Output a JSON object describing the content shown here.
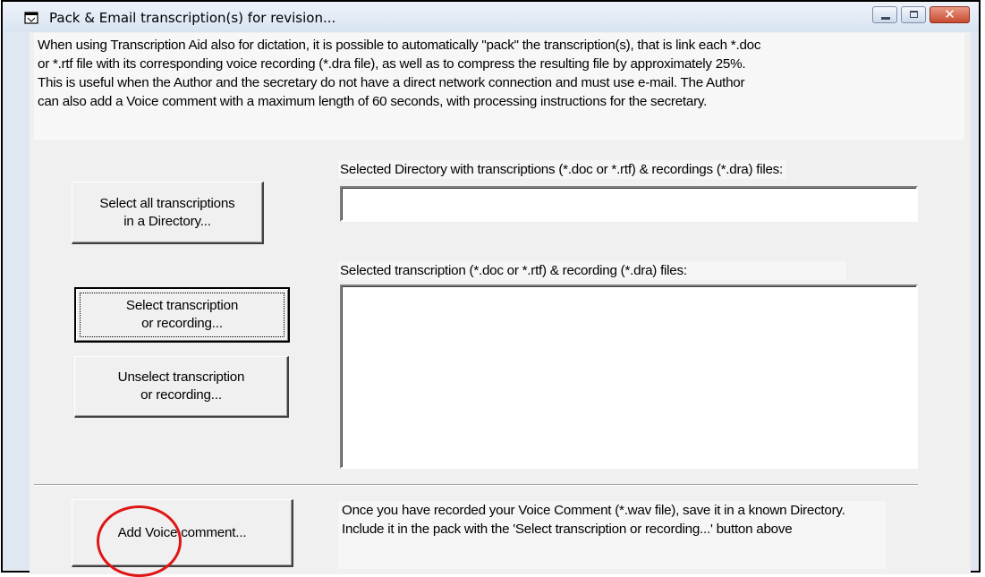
{
  "window": {
    "title": "Pack & Email transcription(s) for revision...",
    "close_glyph": "✕"
  },
  "intro_text": "When using Transcription Aid also for dictation, it is possible to automatically \"pack\" the transcription(s), that is link each *.doc\nor *.rtf file with its corresponding voice recording (*.dra file), as well as to compress the resulting file by approximately 25%.\nThis is useful when the Author and the secretary do not have a direct network connection and must use e-mail. The Author\ncan also add a Voice comment with a maximum length of 60 seconds, with processing instructions for the secretary.",
  "directory": {
    "label": "Selected Directory with transcriptions (*.doc or *.rtf) & recordings (*.dra) files:",
    "value": ""
  },
  "files": {
    "label": "Selected transcription (*.doc or *.rtf) & recording (*.dra) files:",
    "items": []
  },
  "buttons": {
    "select_all": "Select all transcriptions\nin a Directory...",
    "select_one": "Select transcription\nor recording...",
    "unselect_one": "Unselect transcription\nor recording...",
    "add_voice": "Add Voice comment..."
  },
  "voice_note": "Once you have recorded your Voice Comment (*.wav file), save it in a known Directory. Include it in the pack with the 'Select transcription or recording...' button above",
  "colors": {
    "annotation_circle": "#e01515",
    "close_button": "#c84a30"
  }
}
